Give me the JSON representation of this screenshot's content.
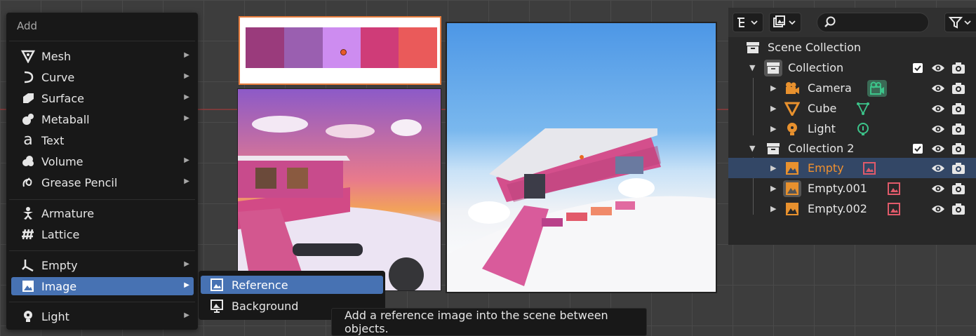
{
  "add_menu": {
    "title": "Add",
    "items": [
      {
        "label": "Mesh",
        "icon": "mesh-icon",
        "has_submenu": true
      },
      {
        "label": "Curve",
        "icon": "curve-icon",
        "has_submenu": true
      },
      {
        "label": "Surface",
        "icon": "surface-icon",
        "has_submenu": true
      },
      {
        "label": "Metaball",
        "icon": "metaball-icon",
        "has_submenu": true
      },
      {
        "label": "Text",
        "icon": "text-icon",
        "has_submenu": false
      },
      {
        "label": "Volume",
        "icon": "volume-icon",
        "has_submenu": true
      },
      {
        "label": "Grease Pencil",
        "icon": "grease-pencil-icon",
        "has_submenu": true
      },
      {
        "label": "Armature",
        "icon": "armature-icon",
        "has_submenu": false
      },
      {
        "label": "Lattice",
        "icon": "lattice-icon",
        "has_submenu": false
      },
      {
        "label": "Empty",
        "icon": "empty-icon",
        "has_submenu": true
      },
      {
        "label": "Image",
        "icon": "image-icon",
        "has_submenu": true,
        "active": true
      },
      {
        "label": "Light",
        "icon": "light-icon",
        "has_submenu": true
      }
    ]
  },
  "image_submenu": {
    "items": [
      {
        "label": "Reference",
        "icon": "reference-image-icon",
        "active": true
      },
      {
        "label": "Background",
        "icon": "background-image-icon",
        "active": false
      }
    ]
  },
  "tooltip": {
    "text": "Add a reference image into the scene between objects."
  },
  "palette": {
    "swatches": [
      "#9a3b7c",
      "#9a5fb0",
      "#cd8cf0",
      "#cf3c78",
      "#ea5a5a"
    ]
  },
  "outliner": {
    "rows": [
      {
        "label": "Scene Collection",
        "icon": "scene-collection-icon"
      },
      {
        "label": "Collection",
        "icon": "collection-icon",
        "checked": true
      },
      {
        "label": "Camera",
        "icon": "camera-object-icon",
        "extra_icon": "camera-data-icon"
      },
      {
        "label": "Cube",
        "icon": "mesh-object-icon",
        "extra_icon": "mesh-data-icon"
      },
      {
        "label": "Light",
        "icon": "light-object-icon",
        "extra_icon": "light-data-icon"
      },
      {
        "label": "Collection 2",
        "icon": "collection-icon",
        "checked": true
      },
      {
        "label": "Empty",
        "icon": "image-empty-icon",
        "extra_icon": "image-data-icon",
        "selected": true
      },
      {
        "label": "Empty.001",
        "icon": "image-empty-icon",
        "extra_icon": "image-data-icon"
      },
      {
        "label": "Empty.002",
        "icon": "image-empty-icon",
        "extra_icon": "image-data-icon"
      }
    ]
  },
  "colors": {
    "accent": "#4772b3",
    "selected_row": "#334766",
    "active_object_text": "#f0912f",
    "object_orange": "#e8912e",
    "data_green": "#3cc48a",
    "image_data_red": "#e05a6a"
  }
}
